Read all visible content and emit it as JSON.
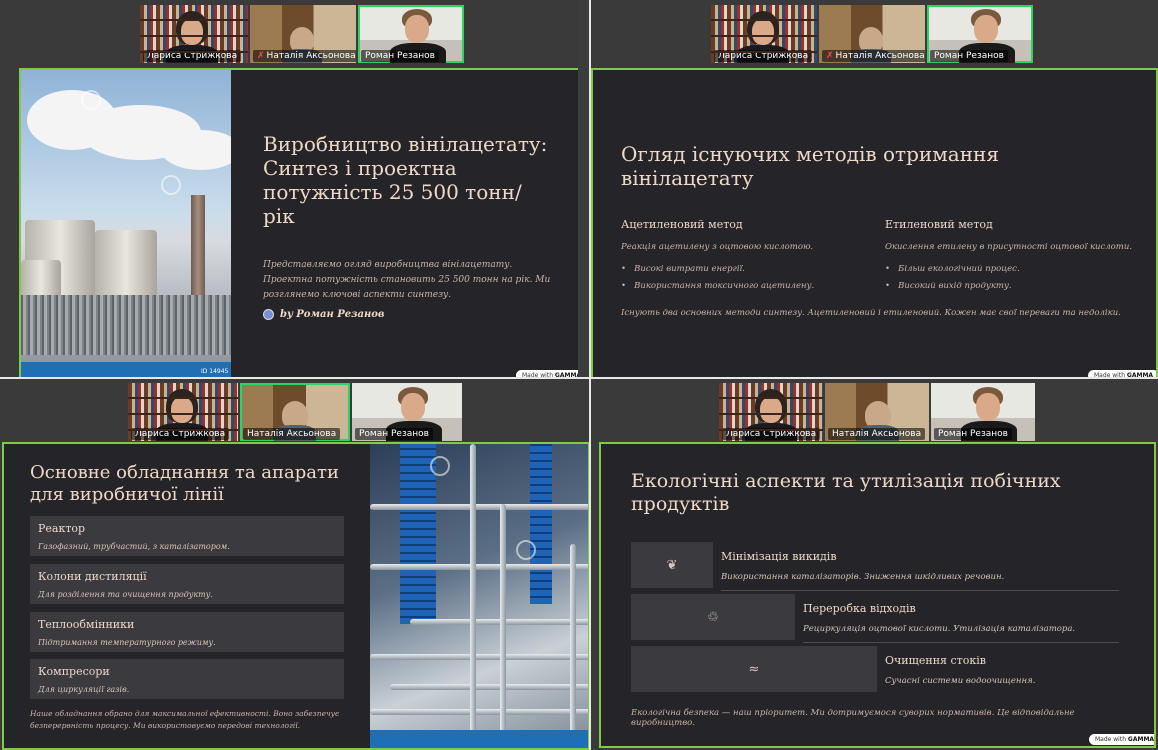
{
  "participants": {
    "p1": "Лариса Стрижкова",
    "p2": "Наталія Аксьонова",
    "p3": "Роман Резанов"
  },
  "made_with": {
    "prefix": "Made with",
    "brand": "GAMMA"
  },
  "slide1": {
    "title": "Виробництво вінілацетату: Синтез і проектна потужність 25 500 тонн/рік",
    "body": "Представляємо огляд виробництва вінілацетату. Проектна потужність становить 25 500 тонн на рік. Ми розглянемо ключові аспекти синтезу.",
    "byline": "by Роман Резанов",
    "photo_id": "ID 14945"
  },
  "slide2": {
    "title": "Огляд існуючих методів отримання вінілацетату",
    "col1": {
      "heading": "Ацетиленовий метод",
      "desc": "Реакція ацетилену з оцтовою кислотою.",
      "bullets": [
        "Високі витрати енергії.",
        "Використання токсичного ацетилену."
      ]
    },
    "col2": {
      "heading": "Етиленовий метод",
      "desc": "Окислення етилену в присутності оцтової кислоти.",
      "bullets": [
        "Більш екологічний процес.",
        "Високий вихід продукту."
      ]
    },
    "footer": "Існують два основних методи синтезу. Ацетиленовий і етиленовий. Кожен має свої переваги та недоліки."
  },
  "slide3": {
    "title": "Основне обладнання та апарати для виробничої лінії",
    "cards": [
      {
        "h": "Реактор",
        "d": "Газофазний, трубчастий, з каталізатором."
      },
      {
        "h": "Колони дистиляції",
        "d": "Для розділення та очищення продукту."
      },
      {
        "h": "Теплообмінники",
        "d": "Підтримання температурного режиму."
      },
      {
        "h": "Компресори",
        "d": "Для циркуляції газів."
      }
    ],
    "footer": "Наше обладнання обрано для максимальної ефективності. Воно забезпечує безперервність процесу. Ми використовуємо передові технології."
  },
  "slide4": {
    "title": "Екологічні аспекти та утилізація побічних продуктів",
    "items": [
      {
        "icon": "leaf-icon",
        "glyph": "❦",
        "h": "Мінімізація викидів",
        "d": "Використання каталізаторів. Зниження шкідливих речовин."
      },
      {
        "icon": "recycle-icon",
        "glyph": "♲",
        "h": "Переробка відходів",
        "d": "Рециркуляція оцтової кислоти. Утилізація каталізатора."
      },
      {
        "icon": "water-icon",
        "glyph": "≈",
        "h": "Очищення стоків",
        "d": "Сучасні системи водоочищення."
      }
    ],
    "footer": "Екологічна безпека — наш пріоритет. Ми дотримуємося суворих нормативів. Це відповідальне виробництво."
  }
}
